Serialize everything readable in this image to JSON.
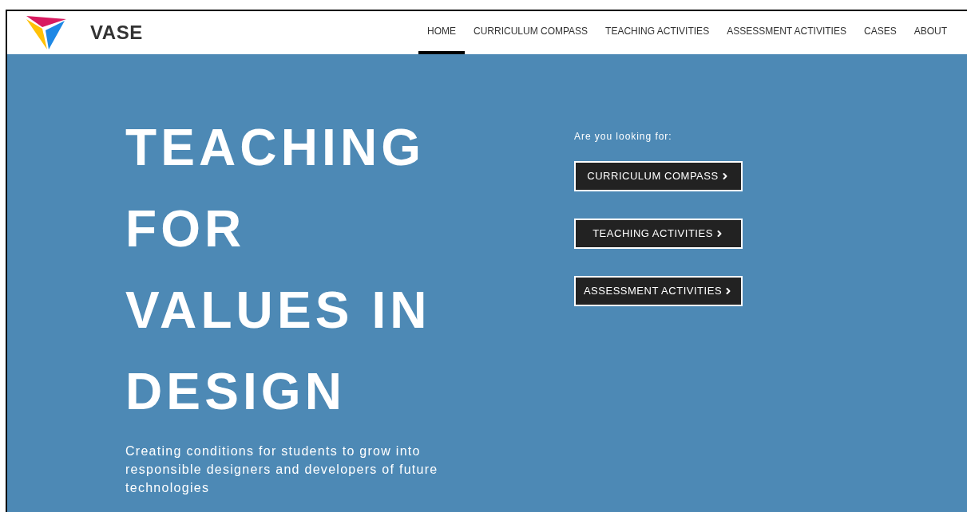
{
  "header": {
    "brand": "VASE",
    "nav": [
      {
        "label": "HOME",
        "selected": true
      },
      {
        "label": "CURRICULUM COMPASS",
        "selected": false
      },
      {
        "label": "TEACHING ACTIVITIES",
        "selected": false
      },
      {
        "label": "ASSESSMENT ACTIVITIES",
        "selected": false
      },
      {
        "label": "CASES",
        "selected": false
      },
      {
        "label": "ABOUT",
        "selected": false
      }
    ]
  },
  "hero": {
    "title_lines": [
      "TEACHING",
      "FOR",
      "VALUES IN",
      "DESIGN"
    ],
    "subtitle": "Creating conditions for students to grow into responsible designers and developers of future technologies",
    "prompt": "Are you looking for:",
    "buttons": [
      "CURRICULUM COMPASS",
      "TEACHING ACTIVITIES",
      "ASSESSMENT ACTIVITIES"
    ]
  }
}
